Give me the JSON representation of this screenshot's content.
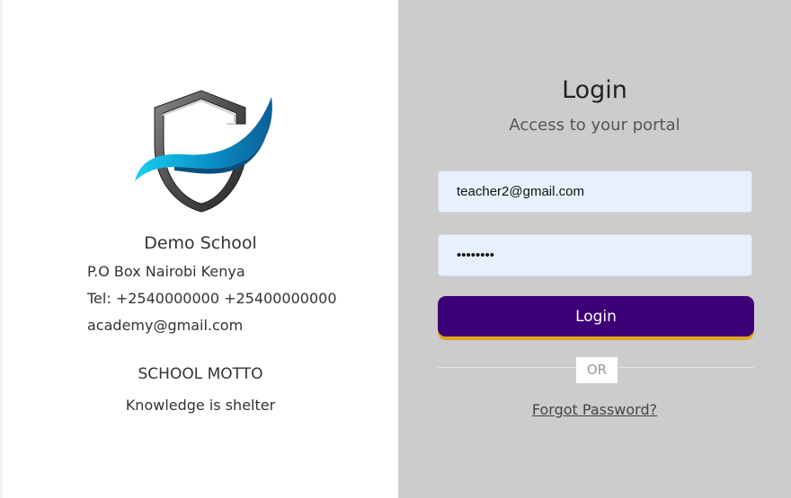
{
  "school": {
    "name": "Demo School",
    "address": "P.O Box Nairobi Kenya",
    "phone": "Tel: +2540000000 +25400000000",
    "email": "academy@gmail.com",
    "motto_title": "SCHOOL MOTTO",
    "motto": "Knowledge is shelter"
  },
  "login": {
    "title": "Login",
    "subtitle": "Access to your portal",
    "email_value": "teacher2@gmail.com",
    "password_value": "••••••••",
    "button_label": "Login",
    "divider_label": "OR",
    "forgot_password": "Forgot Password?"
  },
  "colors": {
    "right_panel_bg": "#cccccc",
    "input_bg": "#e8f0fe",
    "login_button_bg": "#3d0078",
    "login_button_underline": "#e0a41d"
  },
  "icons": {
    "logo": "shield-logo-icon"
  }
}
